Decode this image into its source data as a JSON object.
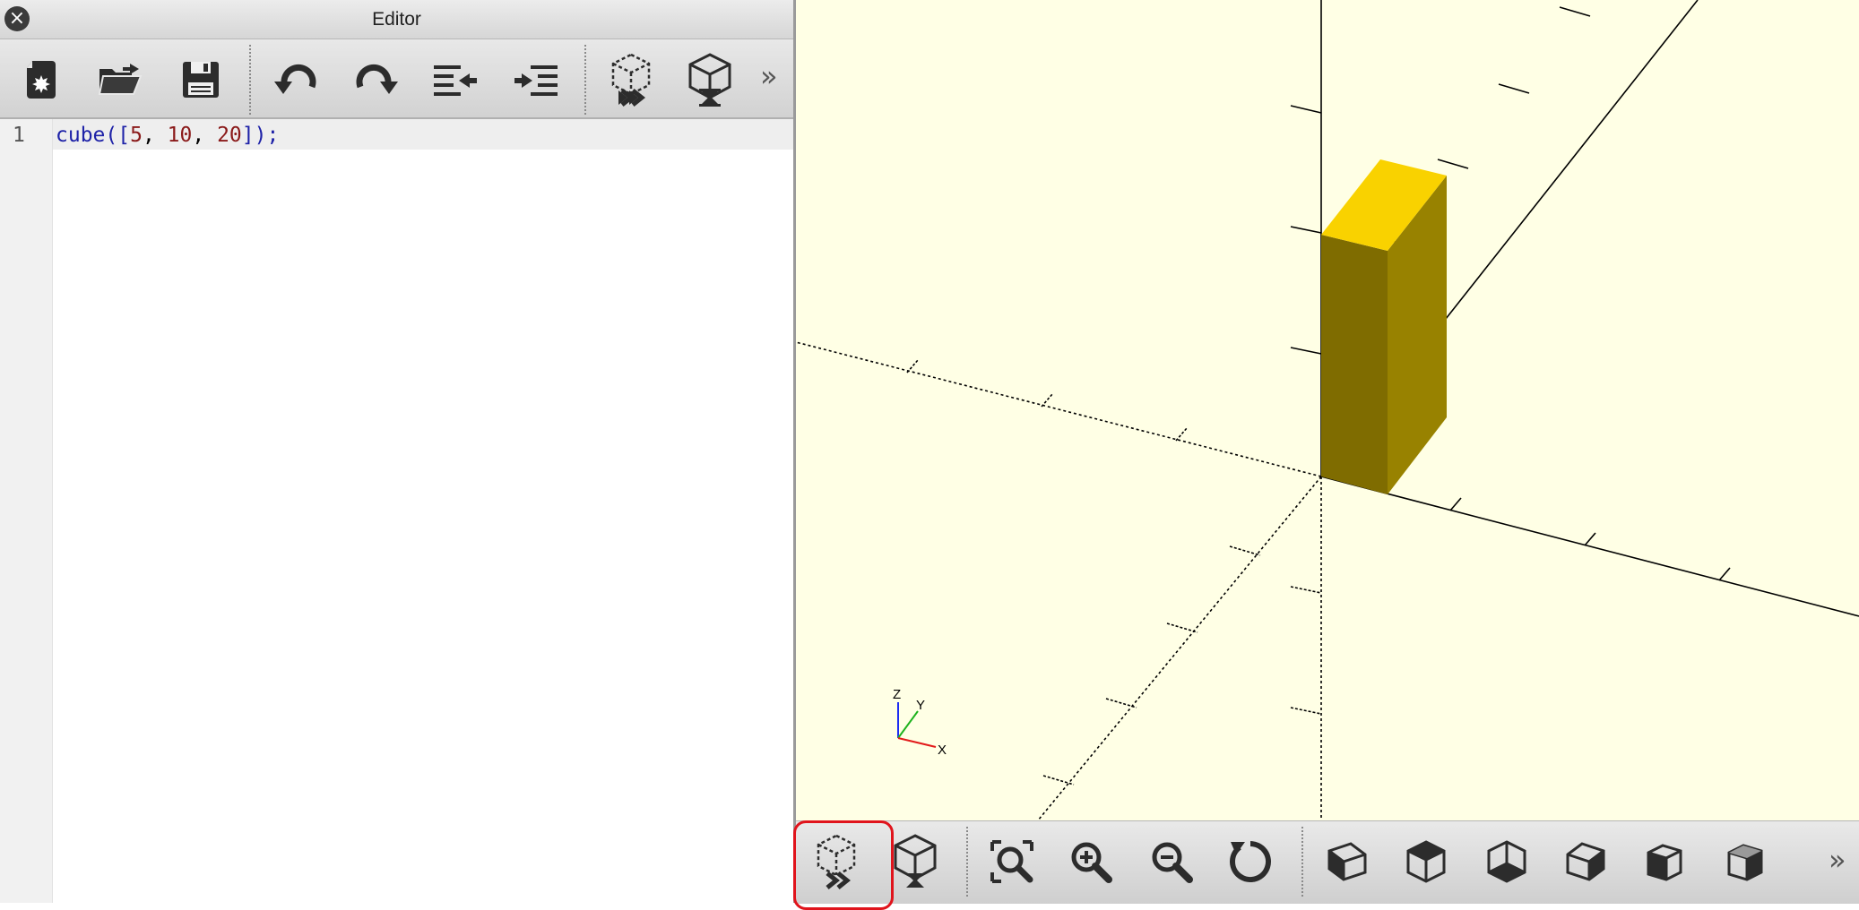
{
  "editor": {
    "title": "Editor",
    "toolbar": {
      "buttons": [
        {
          "name": "new-file-icon"
        },
        {
          "name": "open-file-icon"
        },
        {
          "name": "save-file-icon"
        },
        {
          "name": "undo-icon"
        },
        {
          "name": "redo-icon"
        },
        {
          "name": "unindent-icon"
        },
        {
          "name": "indent-icon"
        },
        {
          "name": "preview-icon"
        },
        {
          "name": "render-icon"
        }
      ],
      "overflow": "»"
    },
    "code": {
      "line_number": "1",
      "tokens": [
        "cube",
        "([",
        "5",
        ", ",
        "10",
        ", ",
        "20",
        "]);"
      ]
    }
  },
  "viewport": {
    "background": "#ffffe5",
    "object_color": "#f9d200",
    "gizmo": {
      "z": "Z",
      "y": "Y",
      "x": "X"
    }
  },
  "view_toolbar": {
    "buttons": [
      {
        "name": "preview-icon",
        "highlighted": true
      },
      {
        "name": "render-icon"
      },
      {
        "name": "view-all-icon"
      },
      {
        "name": "zoom-in-icon"
      },
      {
        "name": "zoom-out-icon"
      },
      {
        "name": "reset-view-icon"
      },
      {
        "name": "view-right-icon"
      },
      {
        "name": "view-top-icon"
      },
      {
        "name": "view-bottom-icon"
      },
      {
        "name": "view-left-icon"
      },
      {
        "name": "view-front-icon"
      },
      {
        "name": "view-back-icon"
      }
    ],
    "overflow": "»",
    "highlight_color": "#e0141c"
  }
}
